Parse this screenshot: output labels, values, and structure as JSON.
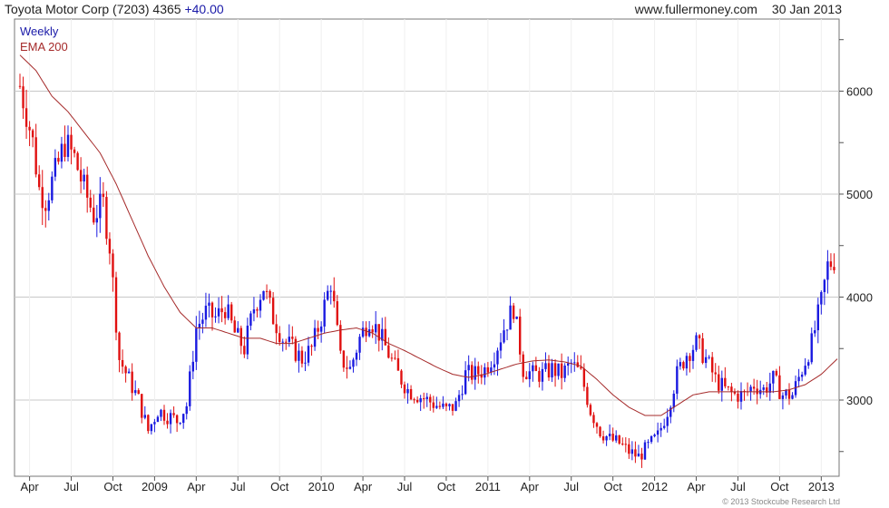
{
  "header": {
    "title": "Toyota Motor Corp (7203) 4365",
    "change": "+40.00",
    "site": "www.fullermoney.com",
    "date": "30 Jan 2013"
  },
  "credit": "© 2013 Stockcube Research Ltd",
  "chart_data": {
    "type": "candlestick",
    "ylim": [
      2260,
      6700
    ],
    "yticks": [
      3000,
      4000,
      5000,
      6000
    ],
    "grid": true,
    "legend_position": "top-left",
    "legend": [
      {
        "label": "Weekly",
        "color": "#1a1aa8"
      },
      {
        "label": "EMA 200",
        "color": "#a52a2a"
      }
    ],
    "colors": {
      "up": "#1a1ae0",
      "down": "#e01010",
      "ema": "#a52a2a"
    },
    "x_ticks": [
      {
        "label": "Apr",
        "week": 3
      },
      {
        "label": "Jul",
        "week": 16
      },
      {
        "label": "Oct",
        "week": 29
      },
      {
        "label": "2009",
        "week": 42
      },
      {
        "label": "Apr",
        "week": 55
      },
      {
        "label": "Jul",
        "week": 68
      },
      {
        "label": "Oct",
        "week": 81
      },
      {
        "label": "2010",
        "week": 94
      },
      {
        "label": "Apr",
        "week": 107
      },
      {
        "label": "Jul",
        "week": 120
      },
      {
        "label": "Oct",
        "week": 133
      },
      {
        "label": "2011",
        "week": 146
      },
      {
        "label": "Apr",
        "week": 159
      },
      {
        "label": "Jul",
        "week": 172
      },
      {
        "label": "Oct",
        "week": 185
      },
      {
        "label": "2012",
        "week": 198
      },
      {
        "label": "Apr",
        "week": 211
      },
      {
        "label": "Jul",
        "week": 224
      },
      {
        "label": "Oct",
        "week": 237
      },
      {
        "label": "2013",
        "week": 250
      }
    ],
    "weeks": 255,
    "close_anchors": [
      [
        0,
        6050
      ],
      [
        2,
        5800
      ],
      [
        4,
        5500
      ],
      [
        6,
        5050
      ],
      [
        8,
        4950
      ],
      [
        11,
        5200
      ],
      [
        14,
        5500
      ],
      [
        17,
        5350
      ],
      [
        20,
        5050
      ],
      [
        23,
        4800
      ],
      [
        26,
        4900
      ],
      [
        28,
        4500
      ],
      [
        31,
        3400
      ],
      [
        34,
        3200
      ],
      [
        37,
        3000
      ],
      [
        40,
        2700
      ],
      [
        43,
        2900
      ],
      [
        46,
        2850
      ],
      [
        49,
        2800
      ],
      [
        52,
        2950
      ],
      [
        55,
        3700
      ],
      [
        58,
        3850
      ],
      [
        61,
        3800
      ],
      [
        64,
        3900
      ],
      [
        67,
        3650
      ],
      [
        70,
        3500
      ],
      [
        73,
        3900
      ],
      [
        76,
        4100
      ],
      [
        79,
        3800
      ],
      [
        82,
        3600
      ],
      [
        85,
        3500
      ],
      [
        88,
        3400
      ],
      [
        91,
        3500
      ],
      [
        94,
        3800
      ],
      [
        97,
        4150
      ],
      [
        100,
        3400
      ],
      [
        103,
        3300
      ],
      [
        106,
        3600
      ],
      [
        109,
        3800
      ],
      [
        112,
        3650
      ],
      [
        115,
        3450
      ],
      [
        118,
        3250
      ],
      [
        121,
        3100
      ],
      [
        124,
        3050
      ],
      [
        127,
        3000
      ],
      [
        130,
        2950
      ],
      [
        133,
        2900
      ],
      [
        136,
        2950
      ],
      [
        139,
        3250
      ],
      [
        142,
        3250
      ],
      [
        145,
        3300
      ],
      [
        148,
        3450
      ],
      [
        151,
        3700
      ],
      [
        154,
        3900
      ],
      [
        157,
        3300
      ],
      [
        160,
        3250
      ],
      [
        163,
        3250
      ],
      [
        166,
        3300
      ],
      [
        169,
        3250
      ],
      [
        172,
        3350
      ],
      [
        175,
        3250
      ],
      [
        178,
        2900
      ],
      [
        181,
        2700
      ],
      [
        184,
        2620
      ],
      [
        187,
        2580
      ],
      [
        190,
        2500
      ],
      [
        193,
        2450
      ],
      [
        196,
        2550
      ],
      [
        199,
        2650
      ],
      [
        202,
        2900
      ],
      [
        205,
        3250
      ],
      [
        208,
        3450
      ],
      [
        211,
        3550
      ],
      [
        214,
        3400
      ],
      [
        217,
        3200
      ],
      [
        220,
        3100
      ],
      [
        223,
        3050
      ],
      [
        226,
        3050
      ],
      [
        229,
        3150
      ],
      [
        232,
        3100
      ],
      [
        235,
        3200
      ],
      [
        238,
        3050
      ],
      [
        241,
        3050
      ],
      [
        244,
        3300
      ],
      [
        247,
        3550
      ],
      [
        250,
        3950
      ],
      [
        252,
        4300
      ],
      [
        254,
        4365
      ]
    ],
    "ema_anchors": [
      [
        0,
        6350
      ],
      [
        5,
        6200
      ],
      [
        10,
        5950
      ],
      [
        15,
        5800
      ],
      [
        20,
        5600
      ],
      [
        25,
        5400
      ],
      [
        30,
        5100
      ],
      [
        35,
        4750
      ],
      [
        40,
        4400
      ],
      [
        45,
        4100
      ],
      [
        50,
        3850
      ],
      [
        55,
        3700
      ],
      [
        60,
        3700
      ],
      [
        65,
        3650
      ],
      [
        70,
        3600
      ],
      [
        75,
        3600
      ],
      [
        80,
        3550
      ],
      [
        85,
        3550
      ],
      [
        90,
        3600
      ],
      [
        95,
        3650
      ],
      [
        100,
        3680
      ],
      [
        105,
        3700
      ],
      [
        110,
        3650
      ],
      [
        115,
        3550
      ],
      [
        120,
        3480
      ],
      [
        125,
        3400
      ],
      [
        130,
        3320
      ],
      [
        135,
        3250
      ],
      [
        140,
        3220
      ],
      [
        145,
        3250
      ],
      [
        150,
        3300
      ],
      [
        155,
        3350
      ],
      [
        160,
        3380
      ],
      [
        165,
        3390
      ],
      [
        170,
        3370
      ],
      [
        175,
        3330
      ],
      [
        180,
        3200
      ],
      [
        185,
        3050
      ],
      [
        190,
        2930
      ],
      [
        195,
        2850
      ],
      [
        200,
        2850
      ],
      [
        205,
        2950
      ],
      [
        210,
        3050
      ],
      [
        215,
        3080
      ],
      [
        220,
        3080
      ],
      [
        225,
        3080
      ],
      [
        230,
        3080
      ],
      [
        235,
        3080
      ],
      [
        240,
        3100
      ],
      [
        245,
        3150
      ],
      [
        250,
        3250
      ],
      [
        255,
        3400
      ]
    ]
  }
}
